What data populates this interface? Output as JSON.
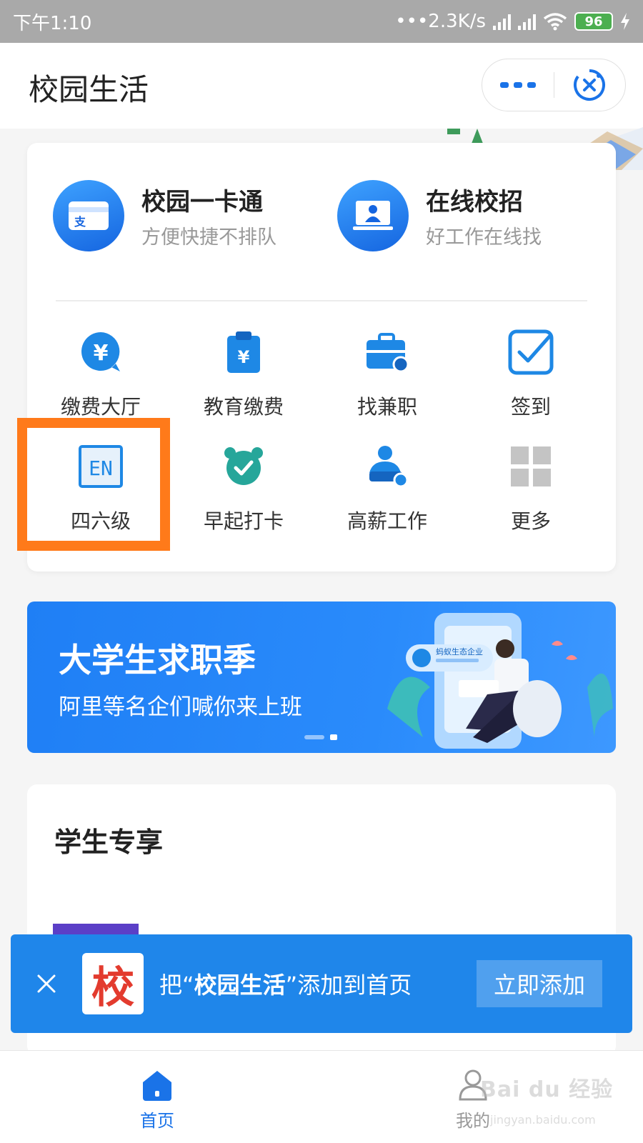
{
  "status_bar": {
    "time": "下午1:10",
    "network_speed": "•••2.3K/s",
    "battery_level": "96",
    "icons": [
      "signal-icon",
      "signal-icon",
      "wifi-icon",
      "battery-icon",
      "charging-icon"
    ]
  },
  "header": {
    "title": "校园生活",
    "more_icon": "more-dots-icon",
    "close_icon": "close-miniprogram-icon"
  },
  "features": [
    {
      "title": "校园一卡通",
      "subtitle": "方便快捷不排队",
      "icon": "card-icon"
    },
    {
      "title": "在线校招",
      "subtitle": "好工作在线找",
      "icon": "recruit-icon"
    }
  ],
  "grid": [
    {
      "label": "缴费大厅",
      "icon": "yuan-bubble-icon"
    },
    {
      "label": "教育缴费",
      "icon": "clipboard-yuan-icon"
    },
    {
      "label": "找兼职",
      "icon": "briefcase-icon"
    },
    {
      "label": "签到",
      "icon": "checkbox-icon"
    },
    {
      "label": "四六级",
      "icon": "en-icon",
      "highlighted": true
    },
    {
      "label": "早起打卡",
      "icon": "alarm-clock-icon"
    },
    {
      "label": "高薪工作",
      "icon": "worker-icon"
    },
    {
      "label": "更多",
      "icon": "grid-more-icon"
    }
  ],
  "banner": {
    "title": "大学生求职季",
    "subtitle": "阿里等名企们喊你来上班",
    "illustration_label": "蚂蚁生态企业",
    "page_index": 2,
    "page_count": 2
  },
  "student_section": {
    "title": "学生专享"
  },
  "add_to_home": {
    "logo_char": "校",
    "text_prefix": "把“",
    "app_name": "校园生活",
    "text_suffix": "”添加到首页",
    "button_label": "立即添加"
  },
  "tabbar": {
    "items": [
      {
        "label": "首页",
        "icon": "home-icon",
        "active": true
      },
      {
        "label": "我的",
        "icon": "user-icon",
        "active": false
      }
    ]
  },
  "watermark": {
    "main": "Bai du 经验",
    "sub": "jingyan.baidu.com"
  },
  "colors": {
    "accent": "#1a73e8",
    "highlight": "#ff7a1a",
    "banner": "#2a8bfb",
    "popup": "#1f86ea",
    "tab_active": "#1a73e8",
    "tab_inactive": "#999999"
  }
}
